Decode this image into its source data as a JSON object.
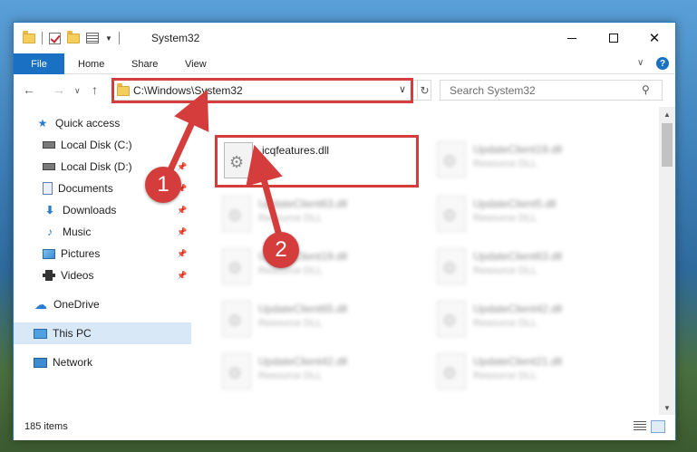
{
  "window": {
    "title": "System32",
    "controls": {
      "minimize": "",
      "maximize": "",
      "close": "✕"
    }
  },
  "ribbon": {
    "file": "File",
    "tabs": [
      "Home",
      "Share",
      "View"
    ],
    "help": "?"
  },
  "address": {
    "path": "C:\\Windows\\System32",
    "refresh": "↻"
  },
  "search": {
    "placeholder": "Search System32"
  },
  "sidebar": {
    "items": [
      {
        "label": "Quick access",
        "icon": "star-icon"
      },
      {
        "label": "Local Disk (C:)",
        "icon": "disk-icon"
      },
      {
        "label": "Local Disk (D:)",
        "icon": "disk-icon",
        "pinned": true
      },
      {
        "label": "Documents",
        "icon": "documents-icon",
        "pinned": true
      },
      {
        "label": "Downloads",
        "icon": "download-icon",
        "pinned": true
      },
      {
        "label": "Music",
        "icon": "music-icon",
        "pinned": true
      },
      {
        "label": "Pictures",
        "icon": "pictures-icon",
        "pinned": true
      },
      {
        "label": "Videos",
        "icon": "videos-icon",
        "pinned": true
      },
      {
        "label": "OneDrive",
        "icon": "cloud-icon"
      },
      {
        "label": "This PC",
        "icon": "pc-icon",
        "selected": true
      },
      {
        "label": "Network",
        "icon": "network-icon"
      }
    ]
  },
  "files": {
    "main": {
      "name": "icqfeatures.dll",
      "type": ""
    },
    "col1": [
      {
        "name": "UpdateClient63.dll",
        "type": "Resource DLL"
      },
      {
        "name": "UpdateClient19.dll",
        "type": "Resource DLL"
      },
      {
        "name": "UpdateClient65.dll",
        "type": "Resource DLL"
      },
      {
        "name": "UpdateClient42.dll",
        "type": "Resource DLL"
      }
    ],
    "col2": [
      {
        "name": "UpdateClient19.dll",
        "type": "Resource DLL"
      },
      {
        "name": "UpdateClient5.dll",
        "type": "Resource DLL"
      },
      {
        "name": "UpdateClient63.dll",
        "type": "Resource DLL"
      },
      {
        "name": "UpdateClient42.dll",
        "type": "Resource DLL"
      },
      {
        "name": "UpdateClient21.dll",
        "type": "Resource DLL"
      }
    ]
  },
  "status": {
    "count": "185 items"
  },
  "annotations": {
    "step1": "1",
    "step2": "2",
    "color": "#d53d3d"
  }
}
